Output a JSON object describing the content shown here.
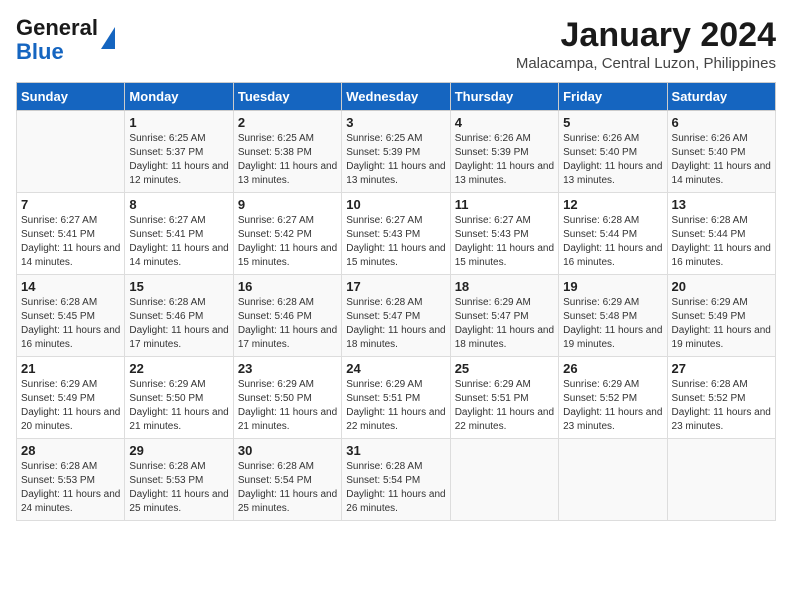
{
  "logo": {
    "general": "General",
    "blue": "Blue"
  },
  "title": "January 2024",
  "subtitle": "Malacampa, Central Luzon, Philippines",
  "days_header": [
    "Sunday",
    "Monday",
    "Tuesday",
    "Wednesday",
    "Thursday",
    "Friday",
    "Saturday"
  ],
  "weeks": [
    [
      {
        "day": "",
        "sunrise": "",
        "sunset": "",
        "daylight": ""
      },
      {
        "day": "1",
        "sunrise": "Sunrise: 6:25 AM",
        "sunset": "Sunset: 5:37 PM",
        "daylight": "Daylight: 11 hours and 12 minutes."
      },
      {
        "day": "2",
        "sunrise": "Sunrise: 6:25 AM",
        "sunset": "Sunset: 5:38 PM",
        "daylight": "Daylight: 11 hours and 13 minutes."
      },
      {
        "day": "3",
        "sunrise": "Sunrise: 6:25 AM",
        "sunset": "Sunset: 5:39 PM",
        "daylight": "Daylight: 11 hours and 13 minutes."
      },
      {
        "day": "4",
        "sunrise": "Sunrise: 6:26 AM",
        "sunset": "Sunset: 5:39 PM",
        "daylight": "Daylight: 11 hours and 13 minutes."
      },
      {
        "day": "5",
        "sunrise": "Sunrise: 6:26 AM",
        "sunset": "Sunset: 5:40 PM",
        "daylight": "Daylight: 11 hours and 13 minutes."
      },
      {
        "day": "6",
        "sunrise": "Sunrise: 6:26 AM",
        "sunset": "Sunset: 5:40 PM",
        "daylight": "Daylight: 11 hours and 14 minutes."
      }
    ],
    [
      {
        "day": "7",
        "sunrise": "Sunrise: 6:27 AM",
        "sunset": "Sunset: 5:41 PM",
        "daylight": "Daylight: 11 hours and 14 minutes."
      },
      {
        "day": "8",
        "sunrise": "Sunrise: 6:27 AM",
        "sunset": "Sunset: 5:41 PM",
        "daylight": "Daylight: 11 hours and 14 minutes."
      },
      {
        "day": "9",
        "sunrise": "Sunrise: 6:27 AM",
        "sunset": "Sunset: 5:42 PM",
        "daylight": "Daylight: 11 hours and 15 minutes."
      },
      {
        "day": "10",
        "sunrise": "Sunrise: 6:27 AM",
        "sunset": "Sunset: 5:43 PM",
        "daylight": "Daylight: 11 hours and 15 minutes."
      },
      {
        "day": "11",
        "sunrise": "Sunrise: 6:27 AM",
        "sunset": "Sunset: 5:43 PM",
        "daylight": "Daylight: 11 hours and 15 minutes."
      },
      {
        "day": "12",
        "sunrise": "Sunrise: 6:28 AM",
        "sunset": "Sunset: 5:44 PM",
        "daylight": "Daylight: 11 hours and 16 minutes."
      },
      {
        "day": "13",
        "sunrise": "Sunrise: 6:28 AM",
        "sunset": "Sunset: 5:44 PM",
        "daylight": "Daylight: 11 hours and 16 minutes."
      }
    ],
    [
      {
        "day": "14",
        "sunrise": "Sunrise: 6:28 AM",
        "sunset": "Sunset: 5:45 PM",
        "daylight": "Daylight: 11 hours and 16 minutes."
      },
      {
        "day": "15",
        "sunrise": "Sunrise: 6:28 AM",
        "sunset": "Sunset: 5:46 PM",
        "daylight": "Daylight: 11 hours and 17 minutes."
      },
      {
        "day": "16",
        "sunrise": "Sunrise: 6:28 AM",
        "sunset": "Sunset: 5:46 PM",
        "daylight": "Daylight: 11 hours and 17 minutes."
      },
      {
        "day": "17",
        "sunrise": "Sunrise: 6:28 AM",
        "sunset": "Sunset: 5:47 PM",
        "daylight": "Daylight: 11 hours and 18 minutes."
      },
      {
        "day": "18",
        "sunrise": "Sunrise: 6:29 AM",
        "sunset": "Sunset: 5:47 PM",
        "daylight": "Daylight: 11 hours and 18 minutes."
      },
      {
        "day": "19",
        "sunrise": "Sunrise: 6:29 AM",
        "sunset": "Sunset: 5:48 PM",
        "daylight": "Daylight: 11 hours and 19 minutes."
      },
      {
        "day": "20",
        "sunrise": "Sunrise: 6:29 AM",
        "sunset": "Sunset: 5:49 PM",
        "daylight": "Daylight: 11 hours and 19 minutes."
      }
    ],
    [
      {
        "day": "21",
        "sunrise": "Sunrise: 6:29 AM",
        "sunset": "Sunset: 5:49 PM",
        "daylight": "Daylight: 11 hours and 20 minutes."
      },
      {
        "day": "22",
        "sunrise": "Sunrise: 6:29 AM",
        "sunset": "Sunset: 5:50 PM",
        "daylight": "Daylight: 11 hours and 21 minutes."
      },
      {
        "day": "23",
        "sunrise": "Sunrise: 6:29 AM",
        "sunset": "Sunset: 5:50 PM",
        "daylight": "Daylight: 11 hours and 21 minutes."
      },
      {
        "day": "24",
        "sunrise": "Sunrise: 6:29 AM",
        "sunset": "Sunset: 5:51 PM",
        "daylight": "Daylight: 11 hours and 22 minutes."
      },
      {
        "day": "25",
        "sunrise": "Sunrise: 6:29 AM",
        "sunset": "Sunset: 5:51 PM",
        "daylight": "Daylight: 11 hours and 22 minutes."
      },
      {
        "day": "26",
        "sunrise": "Sunrise: 6:29 AM",
        "sunset": "Sunset: 5:52 PM",
        "daylight": "Daylight: 11 hours and 23 minutes."
      },
      {
        "day": "27",
        "sunrise": "Sunrise: 6:28 AM",
        "sunset": "Sunset: 5:52 PM",
        "daylight": "Daylight: 11 hours and 23 minutes."
      }
    ],
    [
      {
        "day": "28",
        "sunrise": "Sunrise: 6:28 AM",
        "sunset": "Sunset: 5:53 PM",
        "daylight": "Daylight: 11 hours and 24 minutes."
      },
      {
        "day": "29",
        "sunrise": "Sunrise: 6:28 AM",
        "sunset": "Sunset: 5:53 PM",
        "daylight": "Daylight: 11 hours and 25 minutes."
      },
      {
        "day": "30",
        "sunrise": "Sunrise: 6:28 AM",
        "sunset": "Sunset: 5:54 PM",
        "daylight": "Daylight: 11 hours and 25 minutes."
      },
      {
        "day": "31",
        "sunrise": "Sunrise: 6:28 AM",
        "sunset": "Sunset: 5:54 PM",
        "daylight": "Daylight: 11 hours and 26 minutes."
      },
      {
        "day": "",
        "sunrise": "",
        "sunset": "",
        "daylight": ""
      },
      {
        "day": "",
        "sunrise": "",
        "sunset": "",
        "daylight": ""
      },
      {
        "day": "",
        "sunrise": "",
        "sunset": "",
        "daylight": ""
      }
    ]
  ]
}
